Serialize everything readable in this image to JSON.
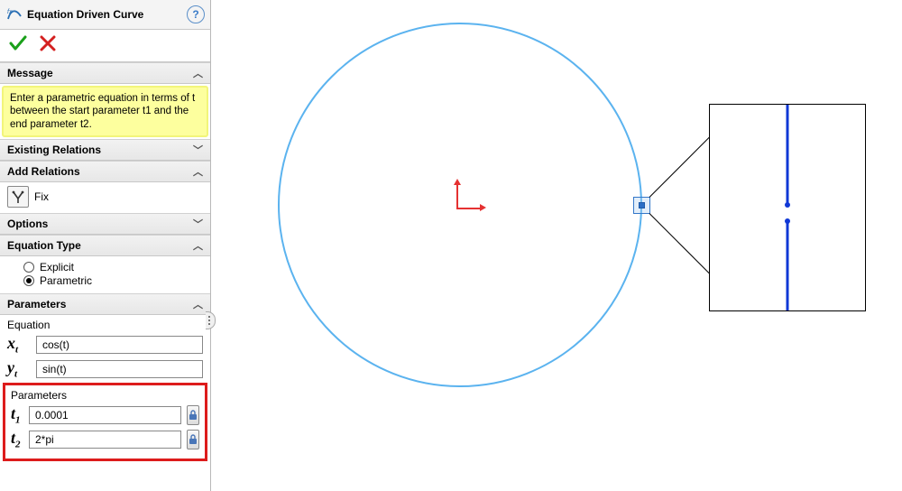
{
  "title": "Equation Driven Curve",
  "sections": {
    "message": {
      "header": "Message",
      "text": "Enter a parametric equation in terms of t between the start parameter t1 and the end parameter t2."
    },
    "existing_relations": {
      "header": "Existing Relations"
    },
    "add_relations": {
      "header": "Add Relations",
      "fix_label": "Fix"
    },
    "options": {
      "header": "Options"
    },
    "equation_type": {
      "header": "Equation Type",
      "explicit": "Explicit",
      "parametric": "Parametric",
      "selected": "parametric"
    },
    "parameters": {
      "header": "Parameters",
      "equation_label": "Equation",
      "xt_label_main": "x",
      "xt_label_sub": "t",
      "yt_label_main": "y",
      "yt_label_sub": "t",
      "xt_value": "cos(t)",
      "yt_value": "sin(t)",
      "params_label": "Parameters",
      "t1_label_main": "t",
      "t1_label_sub": "1",
      "t2_label_main": "t",
      "t2_label_sub": "2",
      "t1_value": "0.0001",
      "t2_value": "2*pi"
    }
  }
}
